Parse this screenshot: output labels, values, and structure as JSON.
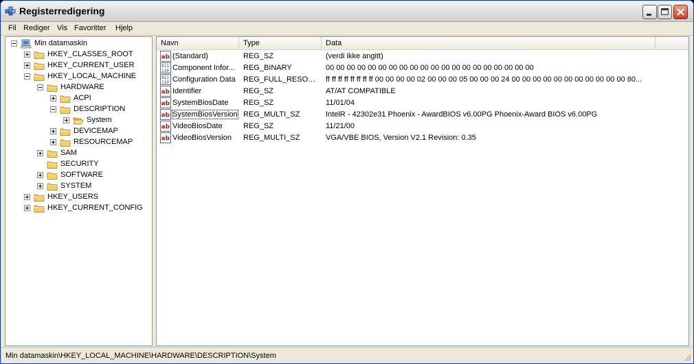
{
  "window": {
    "title": "Registerredigering",
    "accent": "#0831d9"
  },
  "menu": [
    "Fil",
    "Rediger",
    "Vis",
    "Favoritter",
    "Hjelp"
  ],
  "tree": [
    {
      "label": "Min datamaskin",
      "expander": "minus",
      "icon": "computer-icon"
    },
    {
      "label": "HKEY_CLASSES_ROOT",
      "expander": "plus",
      "icon": "folder-icon"
    },
    {
      "label": "HKEY_CURRENT_USER",
      "expander": "plus",
      "icon": "folder-icon"
    },
    {
      "label": "HKEY_LOCAL_MACHINE",
      "expander": "minus",
      "icon": "folder-icon"
    },
    {
      "label": "HARDWARE",
      "expander": "minus",
      "icon": "folder-icon"
    },
    {
      "label": "ACPI",
      "expander": "plus",
      "icon": "folder-icon"
    },
    {
      "label": "DESCRIPTION",
      "expander": "minus",
      "icon": "folder-icon"
    },
    {
      "label": "System",
      "expander": "plus",
      "icon": "open-folder-icon",
      "selected": true
    },
    {
      "label": "DEVICEMAP",
      "expander": "plus",
      "icon": "folder-icon"
    },
    {
      "label": "RESOURCEMAP",
      "expander": "plus",
      "icon": "folder-icon"
    },
    {
      "label": "SAM",
      "expander": "plus",
      "icon": "folder-icon"
    },
    {
      "label": "SECURITY",
      "expander": "none",
      "icon": "folder-icon"
    },
    {
      "label": "SOFTWARE",
      "expander": "plus",
      "icon": "folder-icon"
    },
    {
      "label": "SYSTEM",
      "expander": "plus",
      "icon": "folder-icon"
    },
    {
      "label": "HKEY_USERS",
      "expander": "plus",
      "icon": "folder-icon"
    },
    {
      "label": "HKEY_CURRENT_CONFIG",
      "expander": "plus",
      "icon": "folder-icon"
    }
  ],
  "columns": [
    "Navn",
    "Type",
    "Data"
  ],
  "values": [
    {
      "name": "(Standard)",
      "type": "REG_SZ",
      "data": "(verdi ikke angitt)",
      "icon": "string-value-icon"
    },
    {
      "name": "Component Infor...",
      "type": "REG_BINARY",
      "data": "00 00 00 00 00 00 00 00 00 00 00 00 00 00 00 00 00 00 00 00",
      "icon": "binary-value-icon"
    },
    {
      "name": "Configuration Data",
      "type": "REG_FULL_RESOUR...",
      "data": "ff ff ff ff ff ff ff ff 00 00 00 00 02 00 00 00 05 00 00 00 24 00 00 00 00 00 00 00 00 00 00 00 80...",
      "icon": "binary-value-icon"
    },
    {
      "name": "Identifier",
      "type": "REG_SZ",
      "data": "AT/AT COMPATIBLE",
      "icon": "string-value-icon"
    },
    {
      "name": "SystemBiosDate",
      "type": "REG_SZ",
      "data": "11/01/04",
      "icon": "string-value-icon"
    },
    {
      "name": "SystemBiosVersion",
      "type": "REG_MULTI_SZ",
      "data": "IntelR - 42302e31 Phoenix - AwardBIOS v6.00PG Phoenix-Award BIOS v6.00PG",
      "icon": "string-value-icon",
      "focused": true
    },
    {
      "name": "VideoBiosDate",
      "type": "REG_SZ",
      "data": "11/21/00",
      "icon": "string-value-icon"
    },
    {
      "name": "VideoBiosVersion",
      "type": "REG_MULTI_SZ",
      "data": "VGA/VBE BIOS, Version V2.1 Revision: 0.35",
      "icon": "string-value-icon"
    }
  ],
  "status": "Min datamaskin\\HKEY_LOCAL_MACHINE\\HARDWARE\\DESCRIPTION\\System"
}
